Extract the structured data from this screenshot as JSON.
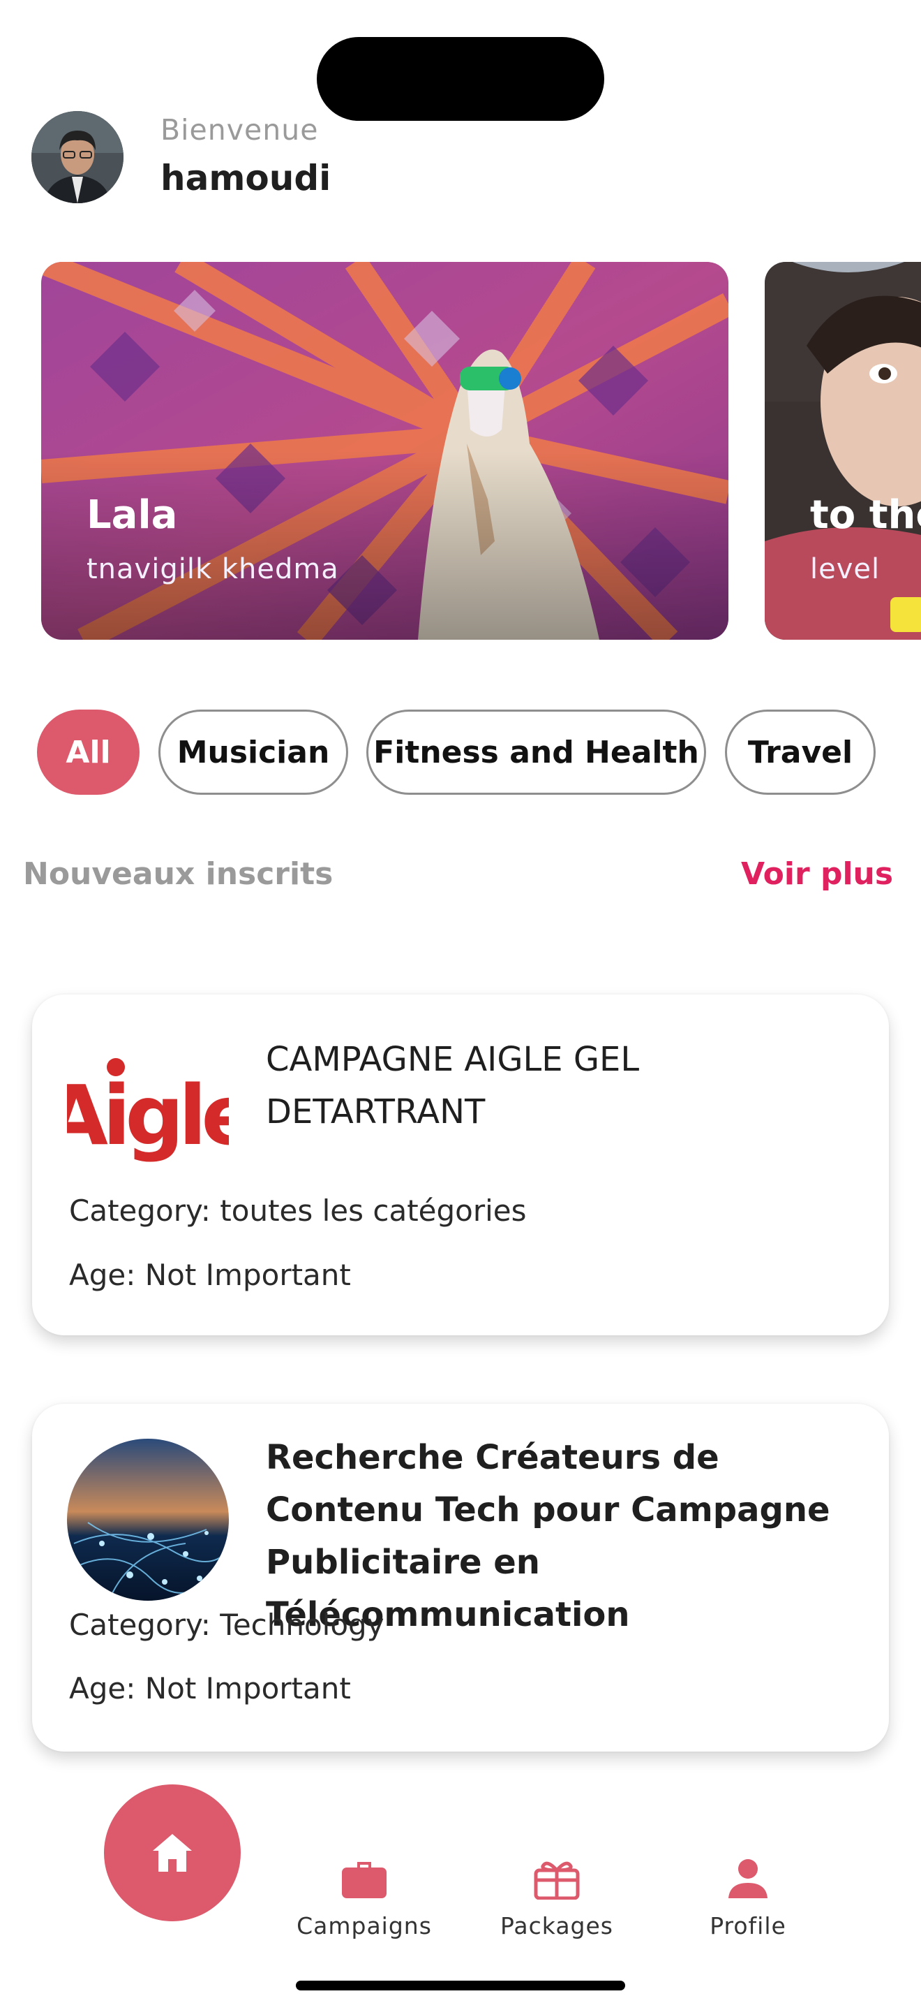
{
  "header": {
    "greeting": "Bienvenue",
    "username": "hamoudi"
  },
  "banners": [
    {
      "title": "Lala",
      "subtitle": "tnavigilk khedma"
    },
    {
      "title": "to the",
      "subtitle": "level"
    }
  ],
  "filters": {
    "chips": [
      "All",
      "Musician",
      "Fitness and Health",
      "Travel"
    ],
    "selected": "All"
  },
  "section": {
    "title": "Nouveaux inscrits",
    "see_more": "Voir plus"
  },
  "campaigns": [
    {
      "logo_text": "Aigle",
      "title": " CAMPAGNE AIGLE GEL DETARTRANT",
      "category": "Category: toutes les catégories",
      "age": "Age: Not Important"
    },
    {
      "title": "Recherche Créateurs de Contenu Tech pour Campagne Publicitaire en Télécommunication",
      "category": "Category: Technology",
      "age": "Age: Not Important"
    }
  ],
  "nav": {
    "campaigns": "Campaigns",
    "packages": "Packages",
    "profile": "Profile"
  },
  "colors": {
    "accent": "#dc5a6c",
    "link": "#e0215f",
    "muted": "#9a9a9a"
  },
  "icons": [
    "home-icon",
    "briefcase-icon",
    "gift-icon",
    "person-icon"
  ]
}
